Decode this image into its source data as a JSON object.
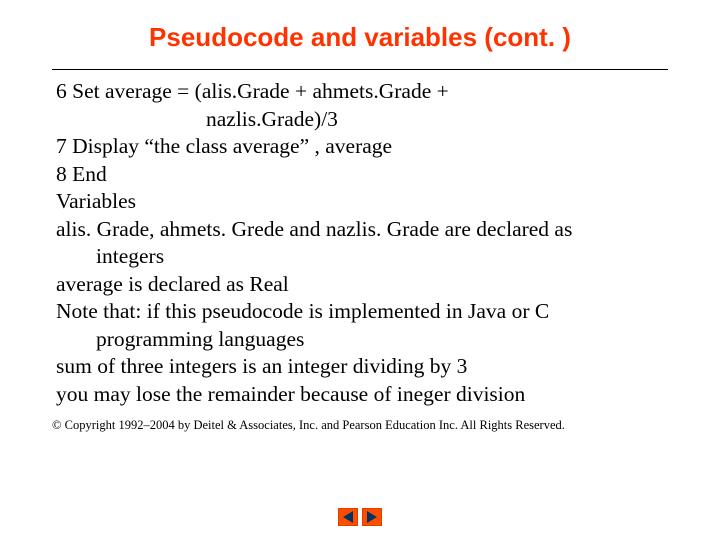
{
  "title": "Pseudocode and variables (cont. )",
  "lines": {
    "l1": "6 Set average = (alis.Grade + ahmets.Grade +",
    "l2": "nazlis.Grade)/3",
    "l3": "7  Display “the class average” , average",
    "l4": "8   End",
    "l5": "Variables",
    "l6": "alis. Grade, ahmets. Grede and nazlis. Grade are declared as",
    "l7": "integers",
    "l8": "average is declared as Real",
    "l9": "Note that: if this pseudocode is implemented in Java or C",
    "l10": "programming languages",
    "l11": "sum of three integers is an integer dividing by 3",
    "l12": "you may lose the remainder because of ineger division"
  },
  "copyright": "© Copyright 1992–2004 by Deitel & Associates, Inc. and Pearson Education Inc. All Rights Reserved.",
  "nav": {
    "prev": "previous",
    "next": "next"
  },
  "colors": {
    "accent": "#ff3300",
    "nav": "#ff4d00"
  }
}
